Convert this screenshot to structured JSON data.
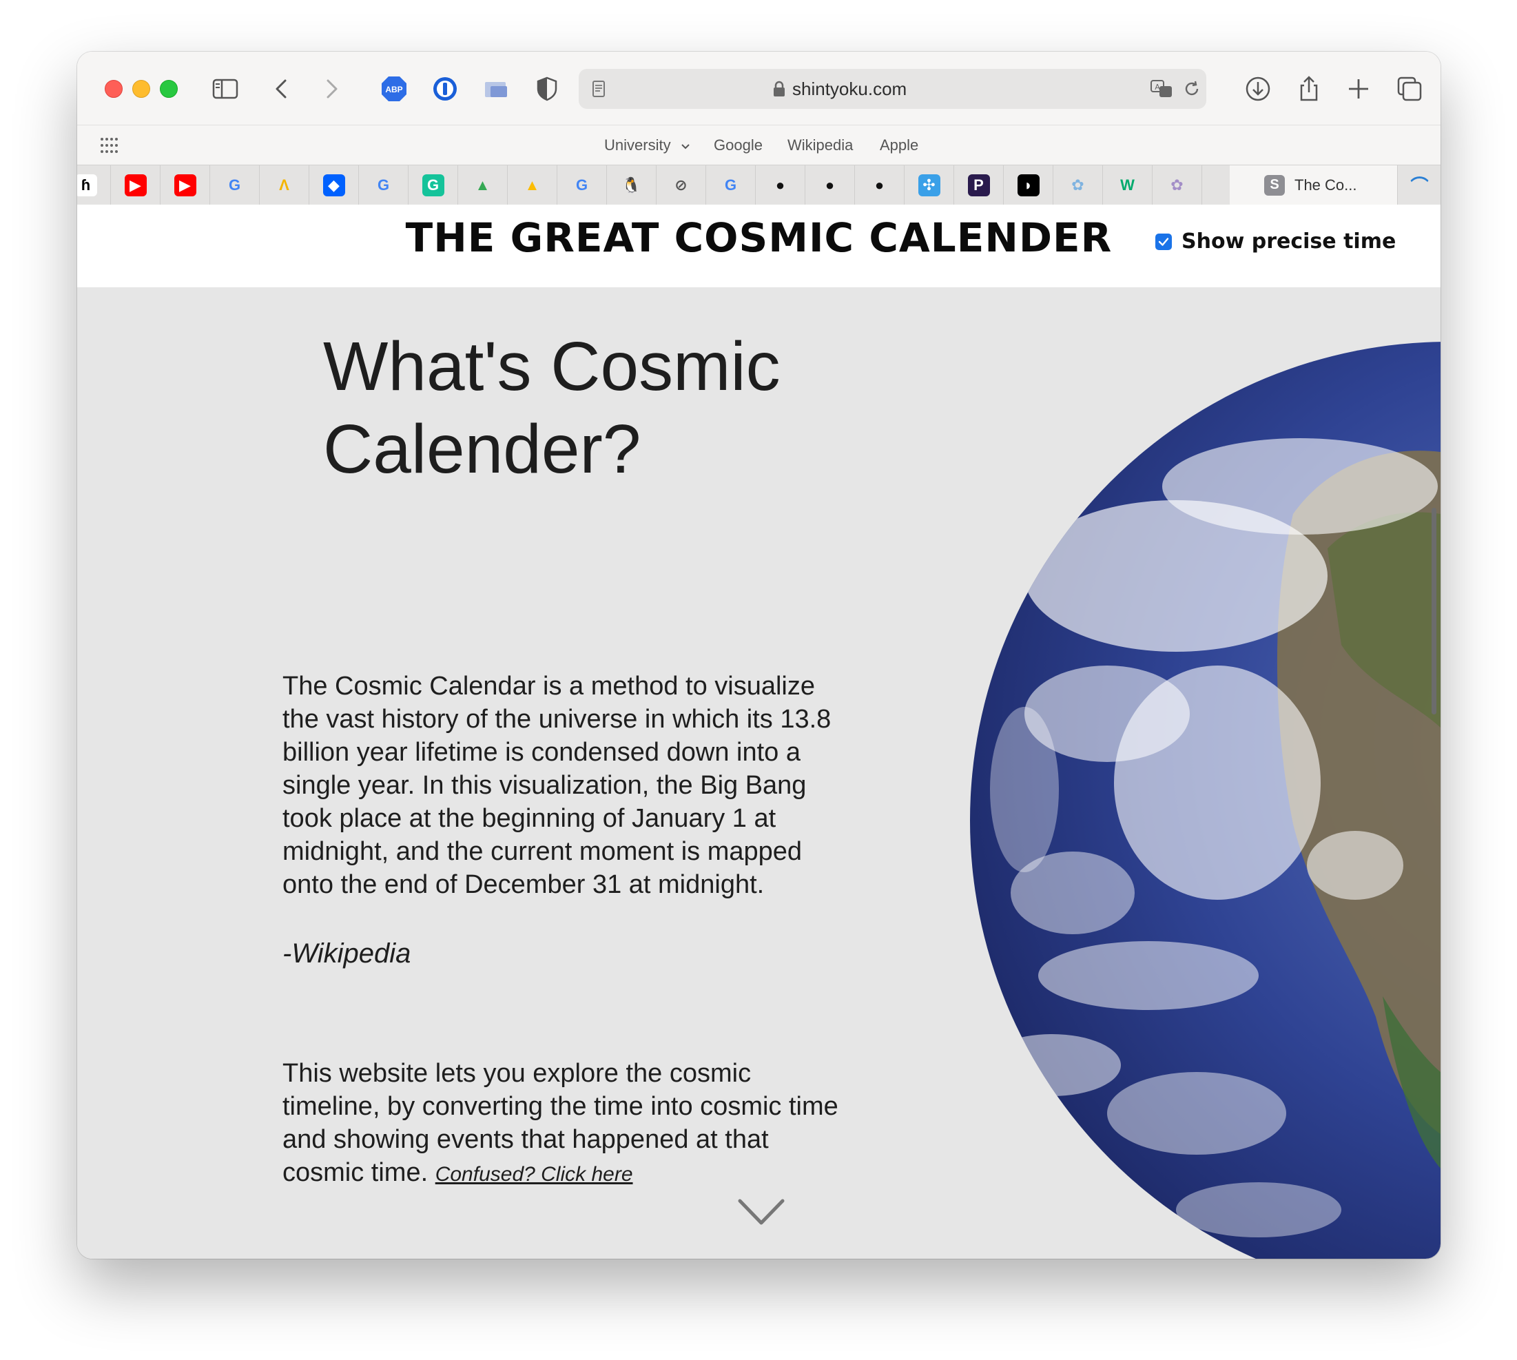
{
  "browser": {
    "url": "shintyoku.com",
    "favorites": {
      "folder_label": "University",
      "items": [
        "Google",
        "Wikipedia",
        "Apple"
      ]
    },
    "active_tab_title": "The Co...",
    "active_tab_favicon_letter": "S",
    "pinned_tabs": [
      {
        "name": "homerow-icon",
        "glyph": "ɦ",
        "bg": "#ffffff",
        "fg": "#000000"
      },
      {
        "name": "youtube-icon",
        "glyph": "▶",
        "bg": "#ff0000",
        "fg": "#ffffff"
      },
      {
        "name": "youtube-icon",
        "glyph": "▶",
        "bg": "#ff0000",
        "fg": "#ffffff"
      },
      {
        "name": "google-icon",
        "glyph": "G",
        "bg": "transparent",
        "fg": "#4285f4"
      },
      {
        "name": "arc-icon",
        "glyph": "Λ",
        "bg": "transparent",
        "fg": "#f4b400"
      },
      {
        "name": "dropbox-icon",
        "glyph": "◆",
        "bg": "#0061fe",
        "fg": "#ffffff"
      },
      {
        "name": "google-icon",
        "glyph": "G",
        "bg": "transparent",
        "fg": "#4285f4"
      },
      {
        "name": "grammarly-icon",
        "glyph": "G",
        "bg": "#15c39a",
        "fg": "#ffffff"
      },
      {
        "name": "google-drive-icon",
        "glyph": "▲",
        "bg": "transparent",
        "fg": "#34a853"
      },
      {
        "name": "google-drive-icon",
        "glyph": "▲",
        "bg": "transparent",
        "fg": "#fbbc05"
      },
      {
        "name": "google-icon",
        "glyph": "G",
        "bg": "transparent",
        "fg": "#4285f4"
      },
      {
        "name": "linux-penguin-icon",
        "glyph": "🐧",
        "bg": "transparent",
        "fg": "#000000"
      },
      {
        "name": "compass-icon",
        "glyph": "⊘",
        "bg": "transparent",
        "fg": "#555555"
      },
      {
        "name": "google-icon",
        "glyph": "G",
        "bg": "transparent",
        "fg": "#4285f4"
      },
      {
        "name": "github-icon",
        "glyph": "●",
        "bg": "transparent",
        "fg": "#111111"
      },
      {
        "name": "github-icon",
        "glyph": "●",
        "bg": "transparent",
        "fg": "#111111"
      },
      {
        "name": "github-icon",
        "glyph": "●",
        "bg": "transparent",
        "fg": "#111111"
      },
      {
        "name": "wiring-icon",
        "glyph": "✣",
        "bg": "#3aa0e8",
        "fg": "#ffffff"
      },
      {
        "name": "proton-icon",
        "glyph": "P",
        "bg": "#2a1b4d",
        "fg": "#ffffff"
      },
      {
        "name": "oracle-bird-icon",
        "glyph": "◗",
        "bg": "#000000",
        "fg": "#ffffff"
      },
      {
        "name": "anime-girl-icon",
        "glyph": "✿",
        "bg": "transparent",
        "fg": "#7fb3e0"
      },
      {
        "name": "w3schools-icon",
        "glyph": "W",
        "bg": "transparent",
        "fg": "#04aa6d"
      },
      {
        "name": "anime-girl-icon",
        "glyph": "✿",
        "bg": "transparent",
        "fg": "#a38ec7"
      }
    ]
  },
  "site": {
    "title": "THE GREAT COSMIC CALENDER",
    "precise_label": "Show precise time",
    "precise_checked": true,
    "heading": "What's Cosmic Calender?",
    "paragraph1": "The Cosmic Calendar is a method to visualize the vast history of the universe in which its 13.8 billion year lifetime is condensed down into a single year. In this visualization, the Big Bang took place at the beginning of January 1 at midnight, and the current moment is mapped onto the end of December 31 at midnight.",
    "source": "-Wikipedia",
    "paragraph2": "This website lets you explore the cosmic timeline, by converting the time into cosmic time and showing events that happened at that cosmic time.",
    "confused_link": "Confused? Click here"
  },
  "colors": {
    "accent": "#1a73e8",
    "page_bg": "#e6e6e6",
    "ocean": "#2e3f8f"
  }
}
